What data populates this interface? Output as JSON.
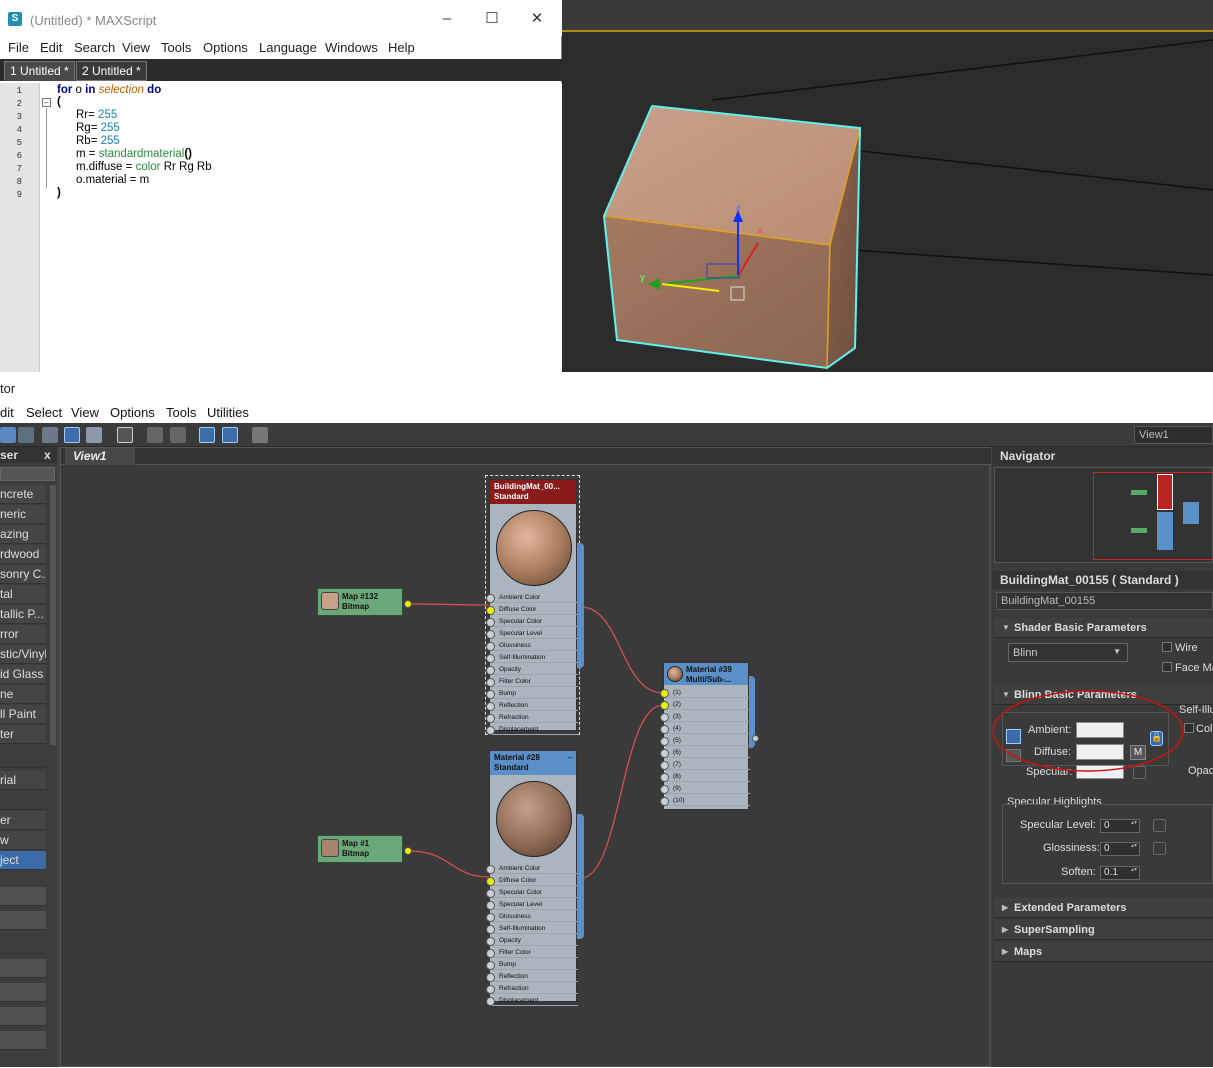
{
  "maxscript": {
    "title": "(Untitled) * MAXScript",
    "app_icon": "S",
    "menu": [
      "File",
      "Edit",
      "Search",
      "View",
      "Tools",
      "Options",
      "Language",
      "Windows",
      "Help"
    ],
    "tabs": [
      "1 Untitled *",
      "2 Untitled *"
    ],
    "line_numbers": [
      "1",
      "2",
      "3",
      "4",
      "5",
      "6",
      "7",
      "8",
      "9"
    ],
    "code": {
      "l1_a": "for",
      "l1_b": " o ",
      "l1_c": "in",
      "l1_d": " selection",
      "l1_e": " do",
      "l2": "(",
      "l3_a": "Rr= ",
      "l3_b": "255",
      "l4_a": "Rg= ",
      "l4_b": "255",
      "l5_a": "Rb= ",
      "l5_b": "255",
      "l6_a": "m = ",
      "l6_b": "standardmaterial",
      "l6_c": "()",
      "l7_a": "m.diffuse = ",
      "l7_b": "color",
      "l7_c": " Rr Rg Rb",
      "l8": "o.material = m",
      "l9": ")"
    }
  },
  "viewport": {
    "gizmo_z": "z",
    "gizmo_y": "y",
    "gizmo_x": "x"
  },
  "slate": {
    "title_fragment": "tor",
    "menu": [
      "dit",
      "Select",
      "View",
      "Options",
      "Tools",
      "Utilities"
    ],
    "browser_header": "ser",
    "browser_close": "x",
    "browser_items": [
      "ncrete",
      "neric",
      "azing",
      "rdwood",
      "sonry C...",
      "tal",
      "tallic P...",
      "rror",
      "stic/Vinyl",
      "id Glass",
      "ne",
      "ll Paint",
      "ter"
    ],
    "browser_items2": [
      "rial",
      "er",
      "w",
      "ject"
    ],
    "view_tab": "View1",
    "view_selector": "View1",
    "nodes": {
      "building": {
        "name": "BuildingMat_00...",
        "type": "Standard"
      },
      "mat28": {
        "name": "Material #28",
        "type": "Standard"
      },
      "multi": {
        "name": "Material #39",
        "type": "Multi/Sub-..."
      },
      "map132": {
        "name": "Map #132",
        "type": "Bitmap"
      },
      "map1": {
        "name": "Map #1",
        "type": "Bitmap"
      }
    },
    "slots": [
      "Ambient Color",
      "Diffuse Color",
      "Specular Color",
      "Specular Level",
      "Glossiness",
      "Self-Illumination",
      "Opacity",
      "Filter Color",
      "Bump",
      "Reflection",
      "Refraction",
      "Displacement"
    ],
    "multi_slots": [
      "(1)",
      "(2)",
      "(3)",
      "(4)",
      "(5)",
      "(6)",
      "(7)",
      "(8)",
      "(9)",
      "(10)"
    ],
    "navigator": "Navigator",
    "material_header": "BuildingMat_00155  ( Standard )",
    "material_name": "BuildingMat_00155",
    "shader_rollout": "Shader Basic Parameters",
    "shader_value": "Blinn",
    "wire_label": "Wire",
    "face_label": "Face Ma",
    "blinn_rollout": "Blinn Basic Parameters",
    "self_illum": "Self-Illu",
    "color_label": "Colo",
    "opacity_label": "Opac",
    "ambient_label": "Ambient:",
    "diffuse_label": "Diffuse:",
    "specular_label": "Specular:",
    "m_button": "M",
    "spec_highlights": "Specular Highlights",
    "spec_level_label": "Specular Level:",
    "spec_level": "0",
    "gloss_label": "Glossiness:",
    "gloss": "0",
    "soften_label": "Soften:",
    "soften": "0.1",
    "extended": "Extended Parameters",
    "supersampling": "SuperSampling",
    "maps": "Maps"
  },
  "colors": {
    "annotation_circle": "#cc1111",
    "ambient_swatch": "#f0f0f0",
    "diffuse_swatch": "#f0f0f0"
  }
}
